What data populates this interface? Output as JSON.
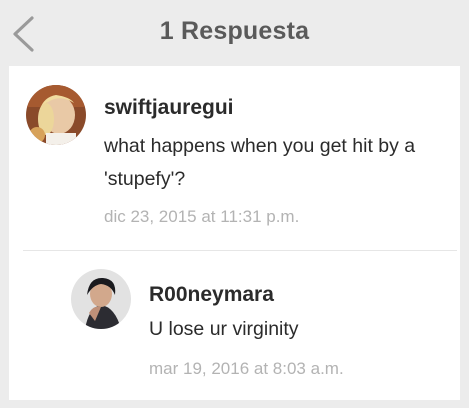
{
  "header": {
    "title": "1 Respuesta",
    "back_icon": "chevron-left-icon"
  },
  "comment": {
    "username": "swiftjauregui",
    "text_line1": "what happens when you get hit by a",
    "text_line2": "'stupefy'?",
    "timestamp": "dic 23, 2015 at 11:31 p.m."
  },
  "reply": {
    "username": "R00neymara",
    "text": "U lose ur virginity",
    "timestamp": "mar 19, 2016 at 8:03 a.m."
  },
  "colors": {
    "background": "#ececec",
    "card": "#ffffff",
    "title": "#5a5a5a",
    "text": "#2b2b2b",
    "timestamp": "#b3b3b3"
  }
}
